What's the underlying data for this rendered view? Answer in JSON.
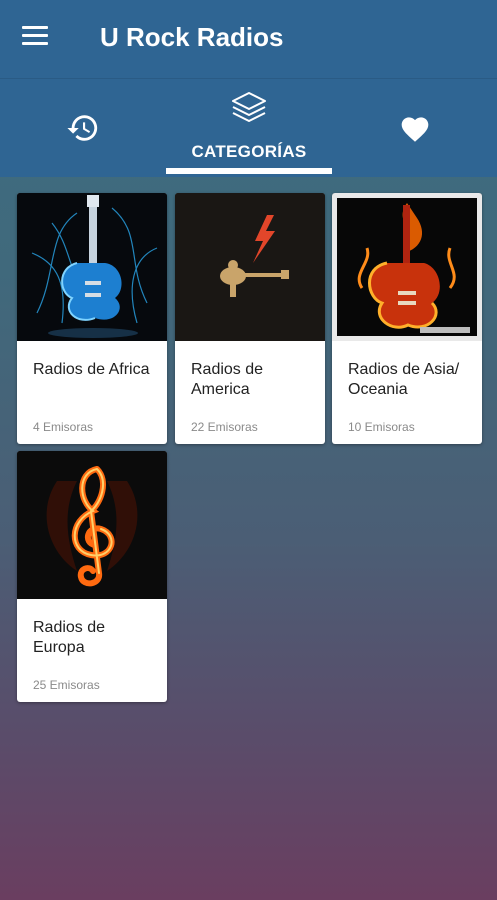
{
  "app": {
    "title": "U Rock Radios"
  },
  "tabs": [
    {
      "id": "history",
      "icon": "history-icon",
      "label": ""
    },
    {
      "id": "categories",
      "icon": "layers-icon",
      "label": "CATEGORÍAS",
      "selected": true
    },
    {
      "id": "favorites",
      "icon": "heart-icon",
      "label": ""
    }
  ],
  "categories": [
    {
      "title": "Radios de Africa",
      "count": "4 Emisoras",
      "image": "blue-neon-guitar"
    },
    {
      "title": "Radios de America",
      "count": "22 Emisoras",
      "image": "dark-guitarist-lightning"
    },
    {
      "title": "Radios de Asia/ Oceania",
      "count": "10 Emisoras",
      "image": "fire-guitar"
    },
    {
      "title": "Radios de Europa",
      "count": "25 Emisoras",
      "image": "fire-treble-clef"
    }
  ],
  "colors": {
    "appbar": "#2f6593",
    "card": "#ffffff",
    "count_text": "#8a8a8a"
  }
}
